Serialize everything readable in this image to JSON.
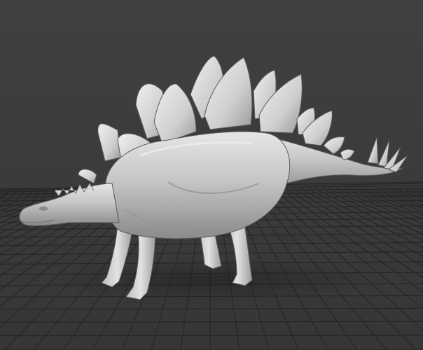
{
  "viewport": {
    "background_color": "#3a3a3a",
    "background_top_color": "#404040",
    "grid_color": "#262626",
    "grid_visible": true
  },
  "model": {
    "name": "stegosaurus-model",
    "material_color": "#c9c9c9",
    "highlight_color": "#f2f2f2",
    "shadow_color": "#6e6e6e",
    "shading": "smooth-gray"
  }
}
